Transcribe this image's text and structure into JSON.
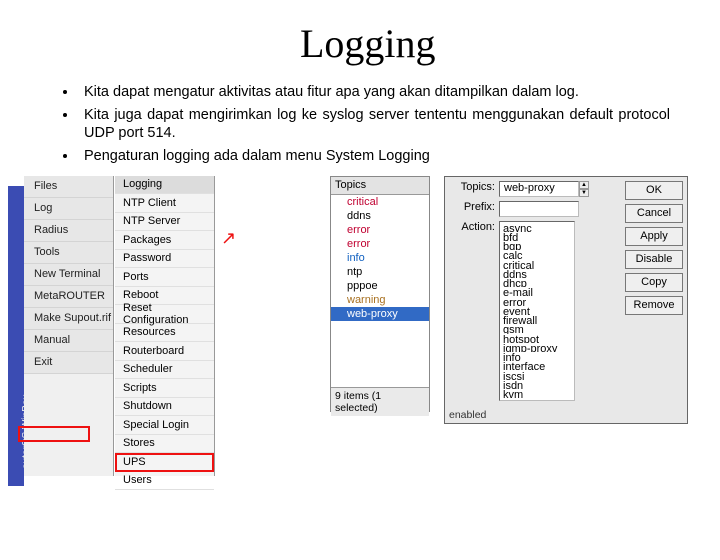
{
  "title": "Logging",
  "bullets": [
    "Kita dapat mengatur aktivitas atau fitur apa yang akan ditampilkan dalam log.",
    "Kita juga dapat mengirimkan log ke syslog server tententu menggunakan default protocol UDP port 514.",
    "Pengaturan logging ada dalam menu System Logging"
  ],
  "sidebar": {
    "brand": "outerOS WinBox",
    "items": [
      "Files",
      "Log",
      "Radius",
      "Tools",
      "New Terminal",
      "MetaROUTER",
      "Make Supout.rif",
      "Manual",
      "Exit"
    ]
  },
  "menu2": {
    "items": [
      "Logging",
      "NTP Client",
      "NTP Server",
      "Packages",
      "Password",
      "Ports",
      "Reboot",
      "Reset Configuration",
      "Resources",
      "Routerboard",
      "Scheduler",
      "Scripts",
      "Shutdown",
      "Special Login",
      "Stores",
      "UPS",
      "Users"
    ]
  },
  "panel1": {
    "header": "Topics",
    "items": [
      "critical",
      "ddns",
      "error",
      "error",
      "info",
      "ntp",
      "pppoe",
      "warning",
      "web-proxy"
    ],
    "status": "9 items (1 selected)"
  },
  "dialog": {
    "labels": {
      "topics": "Topics:",
      "prefix": "Prefix:",
      "action": "Action:"
    },
    "topics_value": "web-proxy",
    "action_items": [
      "async",
      "bfd",
      "bgp",
      "calc",
      "critical",
      "ddns",
      "dhcp",
      "e-mail",
      "error",
      "event",
      "firewall",
      "gsm",
      "hotspot",
      "igmp-proxy",
      "info",
      "interface",
      "iscsi",
      "isdn",
      "kvm"
    ],
    "buttons": [
      "OK",
      "Cancel",
      "Apply",
      "Disable",
      "Copy",
      "Remove"
    ],
    "status": "enabled"
  }
}
